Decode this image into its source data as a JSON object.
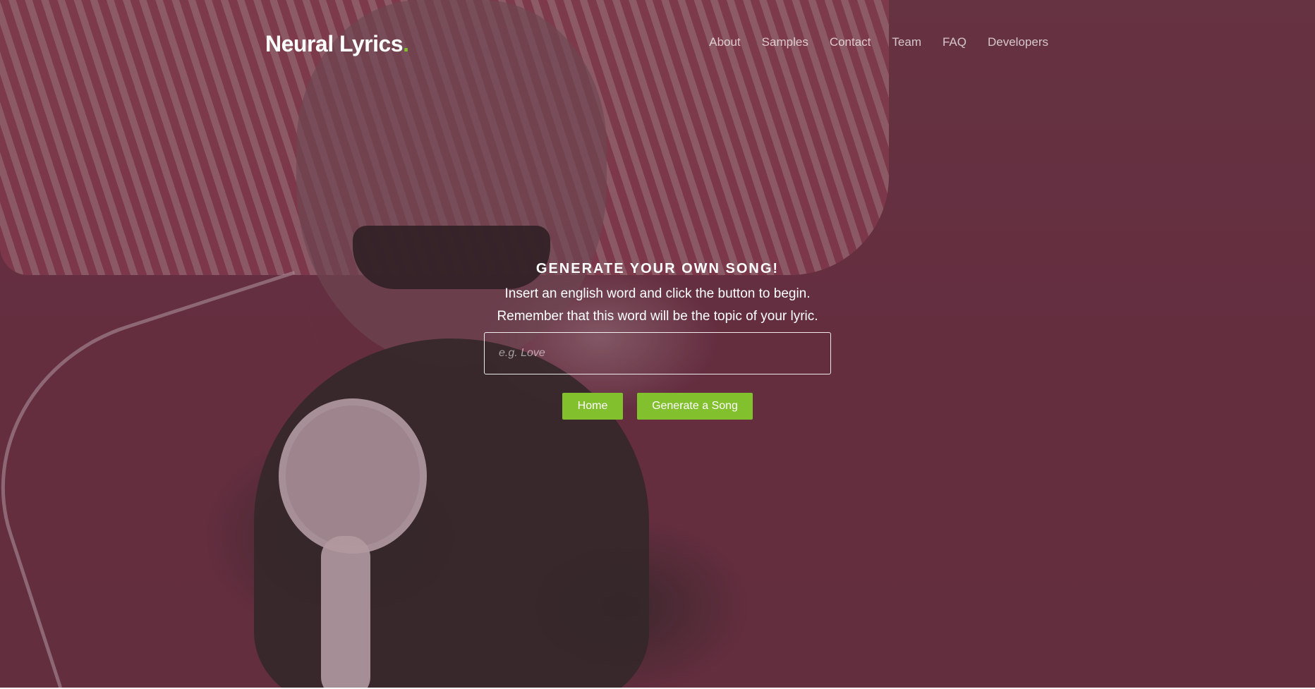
{
  "brand": {
    "name": "Neural Lyrics",
    "dot": "."
  },
  "nav": {
    "items": [
      "About",
      "Samples",
      "Contact",
      "Team",
      "FAQ",
      "Developers"
    ]
  },
  "hero": {
    "heading": "GENERATE YOUR OWN SONG!",
    "line1": "Insert an english word and click the button to begin.",
    "line2": "Remember that this word will be the topic of your lyric.",
    "input_placeholder": "e.g. Love",
    "input_value": ""
  },
  "buttons": {
    "home": "Home",
    "generate": "Generate a Song"
  },
  "colors": {
    "accent": "#82c02e",
    "background": "#6b3346"
  }
}
